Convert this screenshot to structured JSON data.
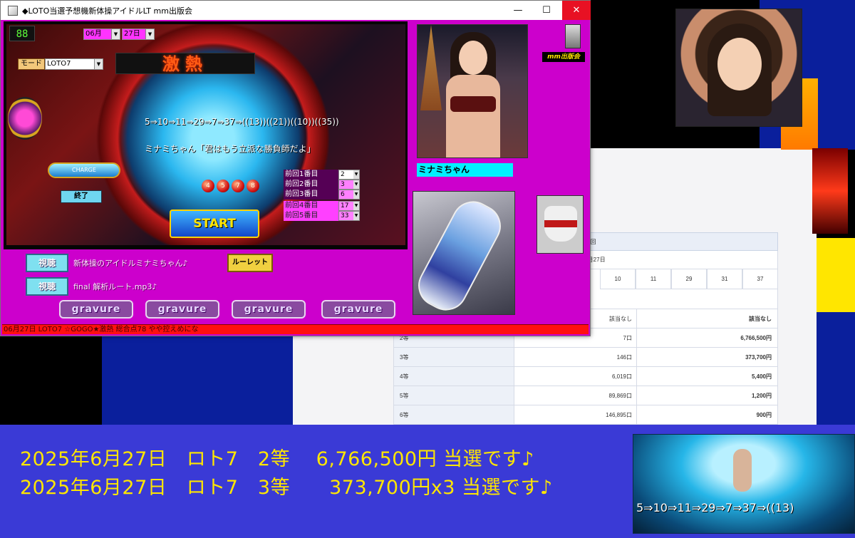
{
  "window": {
    "title": "◆LOTO当選予想機新体操アイドルLT mm出版会",
    "controls": {
      "minimize": "—",
      "maximize": "☐",
      "close": "✕"
    }
  },
  "game": {
    "counter": "88",
    "month": "06月",
    "day": "27日",
    "mode_label": "モード",
    "mode_value": "LOTO7",
    "heat_label": "激熱",
    "sequence": "5⇒10⇒11⇒29⇒7⇒37⇒((13))((21))((10))((35))",
    "quote": "ミナミちゃん「君はもう立派な勝負師だよ」",
    "charge_label": "CHARGE",
    "end_button": "終了",
    "start_button": "START",
    "balls": [
      "4",
      "5",
      "7",
      "8"
    ],
    "previous": [
      {
        "label": "前回1番目",
        "value": "2"
      },
      {
        "label": "前回2番目",
        "value": "3"
      },
      {
        "label": "前回3番目",
        "value": "6"
      },
      {
        "label": "前回4番目",
        "value": "17"
      },
      {
        "label": "前回5番目",
        "value": "33"
      }
    ]
  },
  "side": {
    "minami_label": "ミナミちゃん",
    "mm_label": "mm出版会"
  },
  "bottom": {
    "watch1": "視聴",
    "watch1_caption": "新体操のアイドルミナミちゃん♪",
    "watch2": "視聴",
    "watch2_caption": "final 解析ルート.mp3♪",
    "roulette": "ルーレット",
    "gravure": [
      "gravure",
      "gravure",
      "gravure",
      "gravure"
    ],
    "status": "06月27日 LOTO7 ☆GOGO★激熱 総合点78 やや控えめにな"
  },
  "results": {
    "round": "第632回",
    "date": "2025年6月27日",
    "numbers": [
      "10",
      "11",
      "29",
      "31",
      "37"
    ],
    "rows": [
      {
        "tier": "",
        "count": "該当なし",
        "prize": "該当なし"
      },
      {
        "tier": "2等",
        "count": "7口",
        "prize": "6,766,500円"
      },
      {
        "tier": "3等",
        "count": "146口",
        "prize": "373,700円"
      },
      {
        "tier": "4等",
        "count": "6,019口",
        "prize": "5,400円"
      },
      {
        "tier": "5等",
        "count": "89,869口",
        "prize": "1,200円"
      },
      {
        "tier": "6等",
        "count": "146,895口",
        "prize": "900円"
      }
    ]
  },
  "banner": {
    "line1": "2025年6月27日　ロト7　2等　 6,766,500円 当選です♪",
    "line2": "2025年6月27日　ロト7　3等　　373,700円x3 当選です♪",
    "caption": "5⇒10⇒11⇒29⇒7⇒37⇒((13)"
  }
}
